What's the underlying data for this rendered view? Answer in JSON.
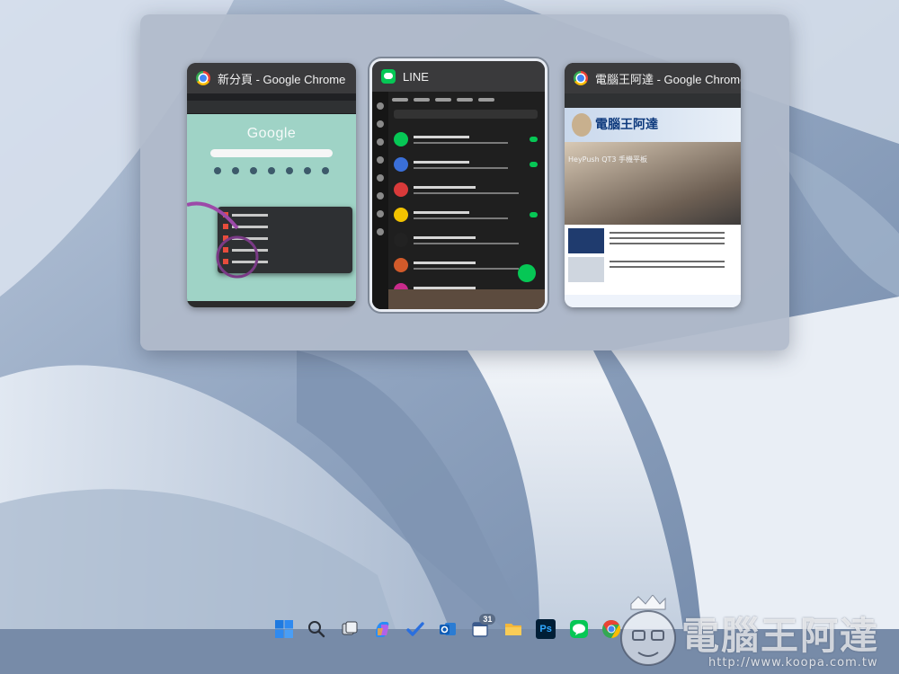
{
  "task_switcher": {
    "windows": [
      {
        "title": "新分頁 - Google Chrome",
        "icon": "chrome-icon",
        "page": {
          "logo_text": "Google"
        }
      },
      {
        "title": "LINE",
        "icon": "line-icon",
        "selected": true
      },
      {
        "title": "電腦王阿達 - Google Chrome",
        "icon": "chrome-icon",
        "page": {
          "brand_text": "電腦王阿達",
          "headline": "HeyPush QT3 手機平板"
        }
      }
    ]
  },
  "taskbar": {
    "items": [
      {
        "name": "start-button",
        "icon": "windows-logo-icon"
      },
      {
        "name": "search-button",
        "icon": "search-icon"
      },
      {
        "name": "task-view-button",
        "icon": "task-view-icon"
      },
      {
        "name": "copilot-button",
        "icon": "copilot-icon"
      },
      {
        "name": "todo-button",
        "icon": "checkmark-icon"
      },
      {
        "name": "outlook-button",
        "icon": "outlook-icon"
      },
      {
        "name": "calendar-button",
        "icon": "calendar-icon",
        "badge": "31"
      },
      {
        "name": "file-explorer-button",
        "icon": "folder-icon"
      },
      {
        "name": "photoshop-button",
        "icon": "photoshop-icon",
        "label": "Ps"
      },
      {
        "name": "line-button",
        "icon": "line-icon"
      },
      {
        "name": "chrome-button",
        "icon": "chrome-icon"
      }
    ]
  },
  "watermark": {
    "name": "電腦王阿達",
    "url": "http://www.koopa.com.tw"
  },
  "colors": {
    "wallpaper_base": "#8ea2be",
    "line_green": "#06c755",
    "switcher_bg": "#b0bacb"
  }
}
